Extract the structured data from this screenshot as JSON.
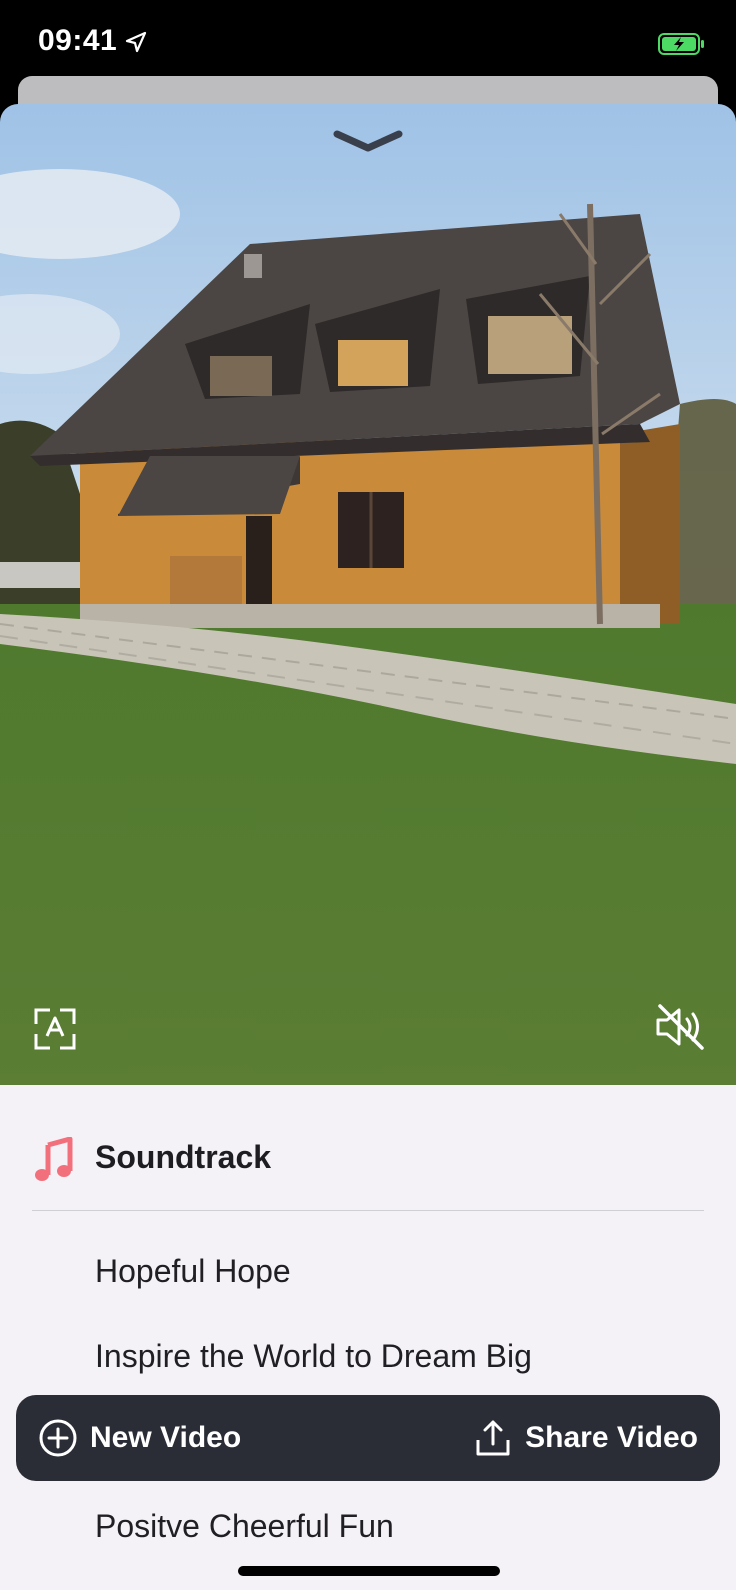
{
  "status_bar": {
    "time": "09:41",
    "icons": [
      "location-arrow-icon",
      "battery-charging-icon"
    ],
    "battery_color": "#4cd964"
  },
  "video": {
    "icons": [
      "chevron-down-icon",
      "auto-crop-icon",
      "speaker-muted-icon"
    ]
  },
  "soundtrack": {
    "title": "Soundtrack",
    "icon": "music-note-icon",
    "icon_color": "#f2707c",
    "tracks": [
      "Hopeful Hope",
      "Inspire the World to Dream Big",
      "Positve Cheerful Fun"
    ]
  },
  "toolbar": {
    "new_video_label": "New Video",
    "share_video_label": "Share Video",
    "icons": [
      "plus-circle-icon",
      "share-icon"
    ],
    "background": "#2a2d36"
  }
}
